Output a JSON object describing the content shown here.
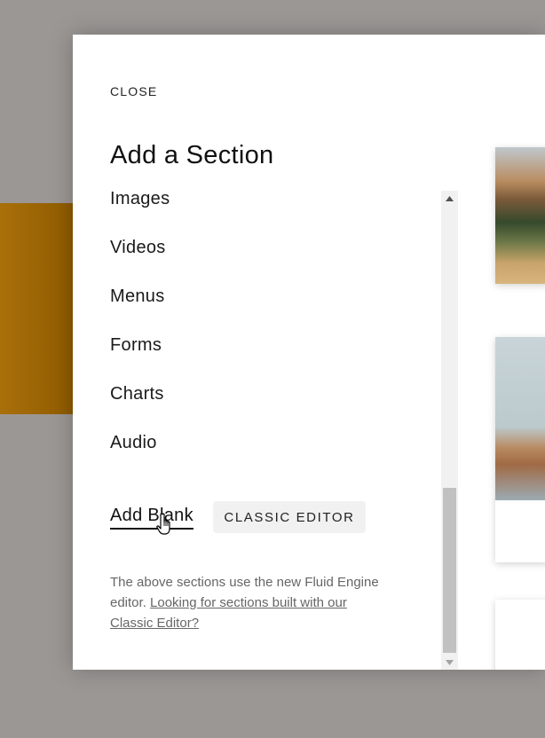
{
  "modal": {
    "close_label": "CLOSE",
    "title": "Add a Section"
  },
  "categories": [
    {
      "label": "Images"
    },
    {
      "label": "Videos"
    },
    {
      "label": "Menus"
    },
    {
      "label": "Forms"
    },
    {
      "label": "Charts"
    },
    {
      "label": "Audio"
    }
  ],
  "actions": {
    "add_blank_label": "Add Blank",
    "classic_editor_label": "CLASSIC EDITOR"
  },
  "note": {
    "text": "The above sections use the new Fluid Engine editor. ",
    "link_text": "Looking for sections built with our Classic Editor?"
  },
  "colors": {
    "backdrop": "#9b9795",
    "accent_panel": "#a06600",
    "modal_bg": "#ffffff",
    "button_bg": "#f1f1f1",
    "scroll_thumb": "#c1c1c1"
  },
  "icons": {
    "scroll_up": "triangle-up-icon",
    "scroll_down": "triangle-down-icon",
    "cursor": "hand-pointer-icon"
  }
}
